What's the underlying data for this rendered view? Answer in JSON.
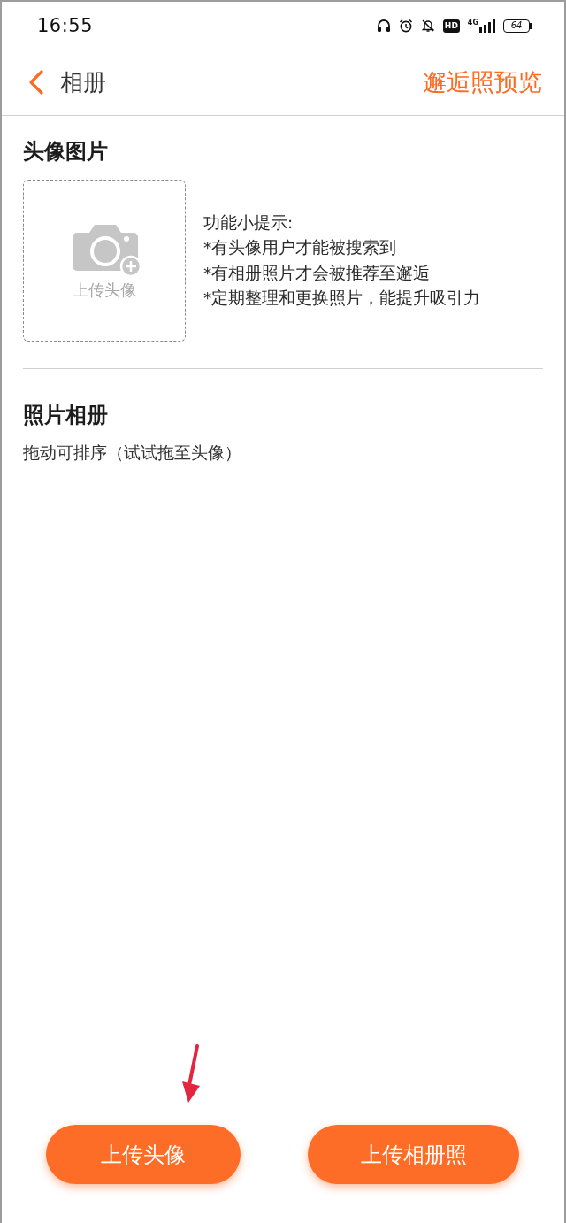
{
  "status_bar": {
    "time": "16:55",
    "hd_badge": "HD",
    "network": "4G",
    "battery": "64"
  },
  "nav": {
    "title": "相册",
    "action": "邂逅照预览"
  },
  "avatar_section": {
    "title": "头像图片",
    "upload_label": "上传头像",
    "tips": [
      "功能小提示:",
      "*有头像用户才能被搜索到",
      "*有相册照片才会被推荐至邂逅",
      "*定期整理和更换照片，能提升吸引力"
    ]
  },
  "album_section": {
    "title": "照片相册",
    "hint": "拖动可排序（试试拖至头像）"
  },
  "buttons": [
    {
      "label": "上传头像",
      "kind": "avatar"
    },
    {
      "label": "上传相册照",
      "kind": "album"
    }
  ]
}
